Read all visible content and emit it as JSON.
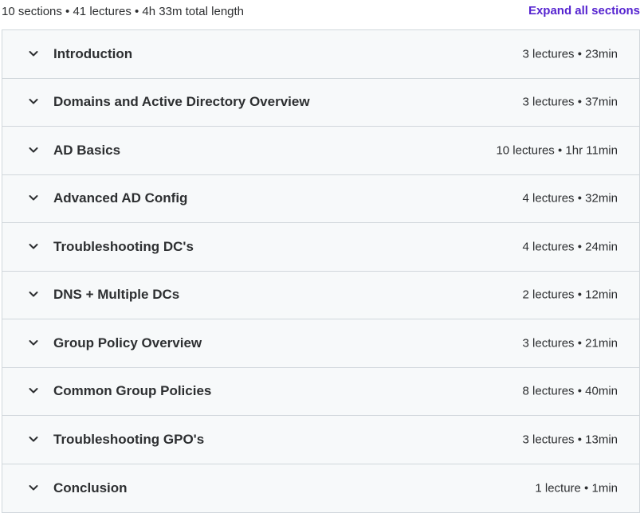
{
  "summary": {
    "text": "10 sections • 41 lectures • 4h 33m total length",
    "expand_label": "Expand all sections"
  },
  "colors": {
    "accent": "#5624d0",
    "row_background": "#f7f9fa",
    "border": "#d1d7dc",
    "text": "#2d2f31"
  },
  "icons": {
    "section_toggle": "chevron-down-icon"
  },
  "sections": [
    {
      "title": "Introduction",
      "meta": "3 lectures • 23min"
    },
    {
      "title": "Domains and Active Directory Overview",
      "meta": "3 lectures • 37min"
    },
    {
      "title": "AD Basics",
      "meta": "10 lectures • 1hr 11min"
    },
    {
      "title": "Advanced AD Config",
      "meta": "4 lectures • 32min"
    },
    {
      "title": "Troubleshooting DC's",
      "meta": "4 lectures • 24min"
    },
    {
      "title": "DNS + Multiple DCs",
      "meta": "2 lectures • 12min"
    },
    {
      "title": "Group Policy Overview",
      "meta": "3 lectures • 21min"
    },
    {
      "title": "Common Group Policies",
      "meta": "8 lectures • 40min"
    },
    {
      "title": "Troubleshooting GPO's",
      "meta": "3 lectures • 13min"
    },
    {
      "title": "Conclusion",
      "meta": "1 lecture • 1min"
    }
  ]
}
